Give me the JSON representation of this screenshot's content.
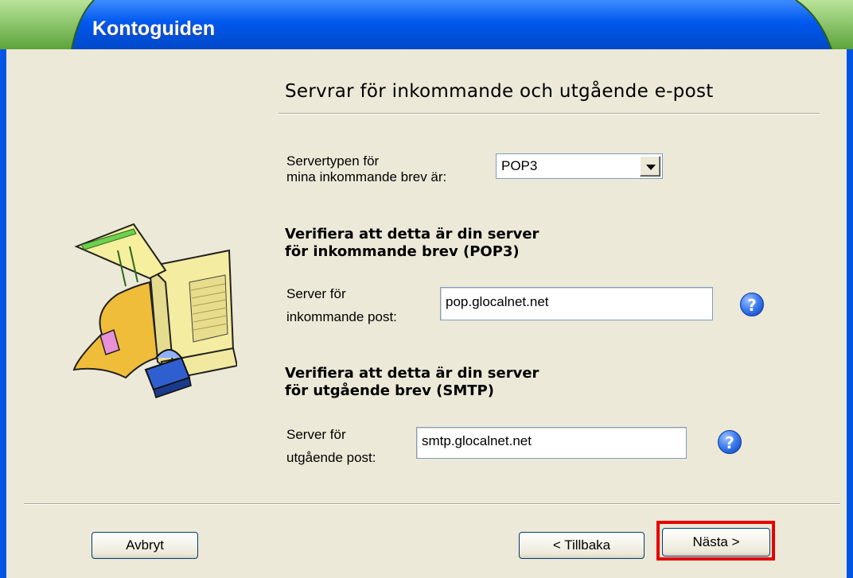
{
  "window": {
    "title": "Kontoguiden"
  },
  "page": {
    "heading": "Servrar för inkommande och utgående e-post"
  },
  "server_type": {
    "label_line1": "Servertypen för",
    "label_line2": "mina inkommande brev är:",
    "selected": "POP3"
  },
  "incoming": {
    "section_line1": "Verifiera att detta är din server",
    "section_line2": "för inkommande brev (POP3)",
    "label_line1": "Server för",
    "label_line2": "inkommande post:",
    "value": "pop.glocalnet.net",
    "help": "?"
  },
  "outgoing": {
    "section_line1": "Verifiera att detta är din server",
    "section_line2": "för utgående brev (SMTP)",
    "label_line1": "Server för",
    "label_line2": "utgående post:",
    "value": "smtp.glocalnet.net",
    "help": "?"
  },
  "buttons": {
    "cancel": "Avbryt",
    "back": "< Tillbaka",
    "next": "Nästa >"
  },
  "colors": {
    "titlebar_blue": "#0058ee",
    "titlebar_green": "#7dbf52",
    "highlight": "#e60000"
  },
  "icons": {
    "illustration": "mail-computer-illustration",
    "help": "help-icon",
    "dropdown": "chevron-down-icon"
  }
}
